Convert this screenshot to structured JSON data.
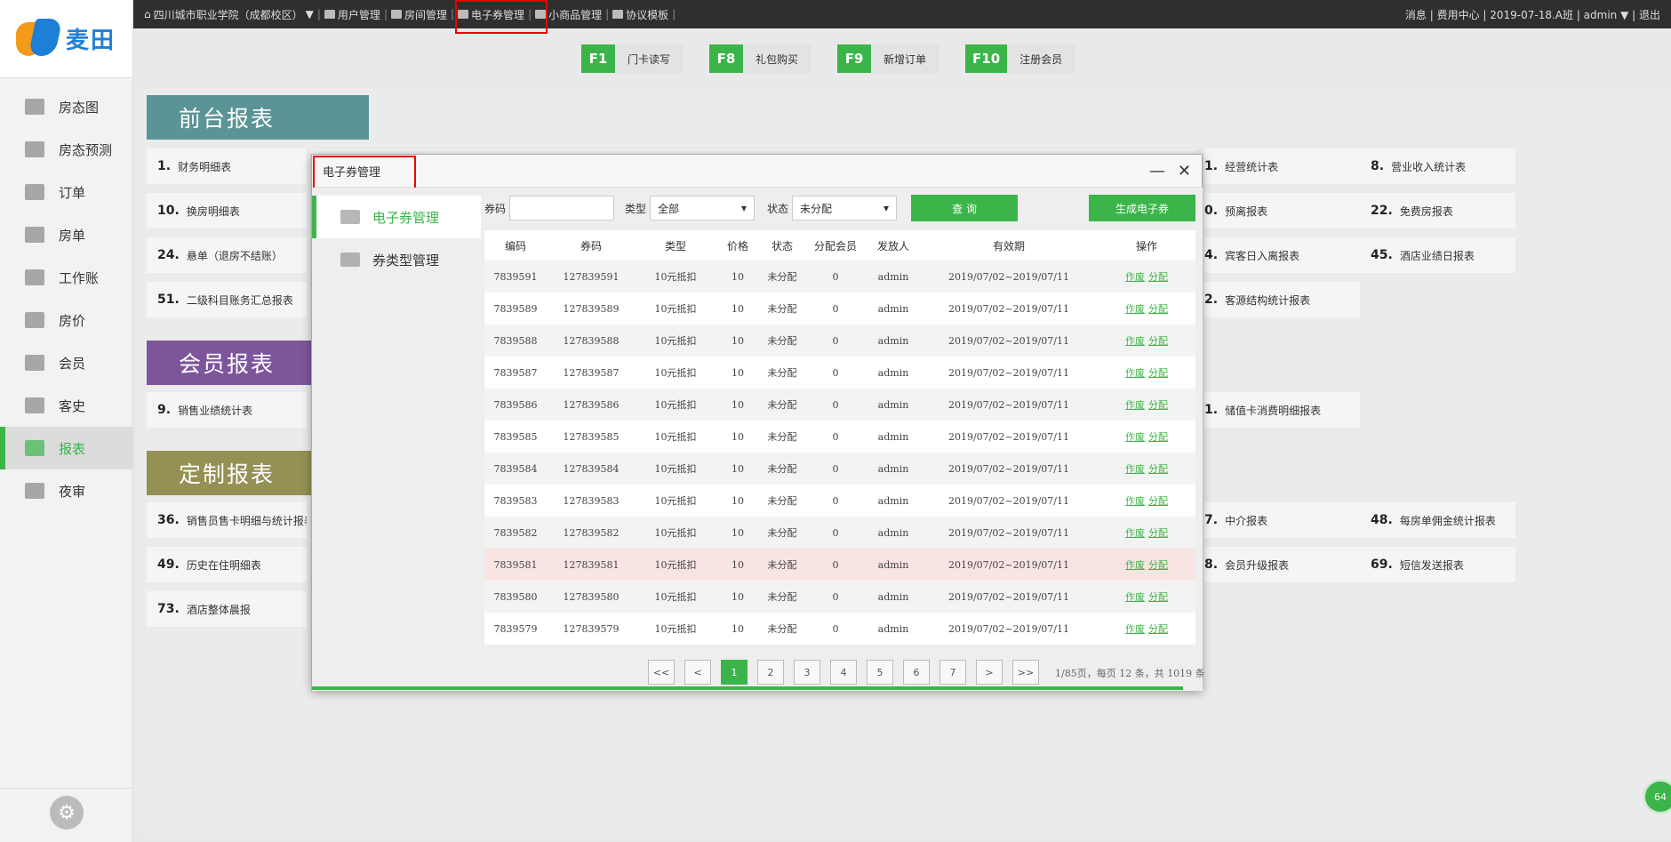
{
  "topbar": {
    "hotel": "四川城市职业学院（成都校区）",
    "nav": [
      "用户管理",
      "房间管理",
      "电子券管理",
      "小商品管理",
      "协议模板"
    ],
    "right": "消息 | 费用中心 | 2019-07-18.A班 | admin ▼ | 退出"
  },
  "brand": "麦田",
  "sidebar": [
    "房态图",
    "房态预测",
    "订单",
    "房单",
    "工作账",
    "房价",
    "会员",
    "客史",
    "报表",
    "夜审"
  ],
  "fkeys": [
    {
      "k": "F1",
      "l": "门卡读写"
    },
    {
      "k": "F8",
      "l": "礼包购买"
    },
    {
      "k": "F9",
      "l": "新增订单"
    },
    {
      "k": "F10",
      "l": "注册会员"
    }
  ],
  "sections": {
    "front": "前台报表",
    "member": "会员报表",
    "custom": "定制报表"
  },
  "reports": {
    "r1": {
      "n": "1.",
      "t": "财务明细表"
    },
    "r10": {
      "n": "10.",
      "t": "换房明细表"
    },
    "r24": {
      "n": "24.",
      "t": "悬单（退房不结账）"
    },
    "r51": {
      "n": "51.",
      "t": "二级科目账务汇总报表"
    },
    "r9": {
      "n": "9.",
      "t": "销售业绩统计表"
    },
    "r36": {
      "n": "36.",
      "t": "销售员售卡明细与统计报表"
    },
    "r49": {
      "n": "49.",
      "t": "历史在住明细表"
    },
    "r73": {
      "n": "73.",
      "t": "酒店整体晨报"
    },
    "c1": {
      "n": "1.",
      "t": "经营统计表"
    },
    "c2": {
      "n": "0.",
      "t": "预离报表"
    },
    "c3": {
      "n": "4.",
      "t": "宾客日入离报表"
    },
    "c4": {
      "n": "2.",
      "t": "客源结构统计报表"
    },
    "c5": {
      "n": "1.",
      "t": "储值卡消费明细报表"
    },
    "c6": {
      "n": "7.",
      "t": "中介报表"
    },
    "c7": {
      "n": "8.",
      "t": "会员升级报表"
    },
    "d1": {
      "n": "8.",
      "t": "营业收入统计表"
    },
    "d2": {
      "n": "22.",
      "t": "免费房报表"
    },
    "d3": {
      "n": "45.",
      "t": "酒店业绩日报表"
    },
    "d4": {
      "n": "48.",
      "t": "每房单佣金统计报表"
    },
    "d5": {
      "n": "69.",
      "t": "短信发送报表"
    }
  },
  "modal": {
    "title": "电子券管理",
    "menu": [
      "电子券管理",
      "券类型管理"
    ],
    "filter": {
      "code_label": "券码",
      "type_label": "类型",
      "type_value": "全部",
      "status_label": "状态",
      "status_value": "未分配",
      "query": "查 询",
      "generate": "生成电子券"
    },
    "headers": [
      "编码",
      "券码",
      "类型",
      "价格",
      "状态",
      "分配会员",
      "发放人",
      "有效期",
      "操作"
    ],
    "rows": [
      [
        "7839591",
        "127839591",
        "10元抵扣",
        "10",
        "未分配",
        "0",
        "admin",
        "2019/07/02~2019/07/11"
      ],
      [
        "7839589",
        "127839589",
        "10元抵扣",
        "10",
        "未分配",
        "0",
        "admin",
        "2019/07/02~2019/07/11"
      ],
      [
        "7839588",
        "127839588",
        "10元抵扣",
        "10",
        "未分配",
        "0",
        "admin",
        "2019/07/02~2019/07/11"
      ],
      [
        "7839587",
        "127839587",
        "10元抵扣",
        "10",
        "未分配",
        "0",
        "admin",
        "2019/07/02~2019/07/11"
      ],
      [
        "7839586",
        "127839586",
        "10元抵扣",
        "10",
        "未分配",
        "0",
        "admin",
        "2019/07/02~2019/07/11"
      ],
      [
        "7839585",
        "127839585",
        "10元抵扣",
        "10",
        "未分配",
        "0",
        "admin",
        "2019/07/02~2019/07/11"
      ],
      [
        "7839584",
        "127839584",
        "10元抵扣",
        "10",
        "未分配",
        "0",
        "admin",
        "2019/07/02~2019/07/11"
      ],
      [
        "7839583",
        "127839583",
        "10元抵扣",
        "10",
        "未分配",
        "0",
        "admin",
        "2019/07/02~2019/07/11"
      ],
      [
        "7839582",
        "127839582",
        "10元抵扣",
        "10",
        "未分配",
        "0",
        "admin",
        "2019/07/02~2019/07/11"
      ],
      [
        "7839581",
        "127839581",
        "10元抵扣",
        "10",
        "未分配",
        "0",
        "admin",
        "2019/07/02~2019/07/11"
      ],
      [
        "7839580",
        "127839580",
        "10元抵扣",
        "10",
        "未分配",
        "0",
        "admin",
        "2019/07/02~2019/07/11"
      ],
      [
        "7839579",
        "127839579",
        "10元抵扣",
        "10",
        "未分配",
        "0",
        "admin",
        "2019/07/02~2019/07/11"
      ]
    ],
    "actions": [
      "作废",
      "分配"
    ],
    "pager": [
      "<<",
      "<",
      "1",
      "2",
      "3",
      "4",
      "5",
      "6",
      "7",
      ">",
      ">>"
    ],
    "pager_info": "1/85页，每页 12 条，共 1019 条"
  },
  "float": "64",
  "colors": {
    "accent": "#3bb54a",
    "front": "#5b9496",
    "member": "#7d559a",
    "custom": "#959155"
  }
}
